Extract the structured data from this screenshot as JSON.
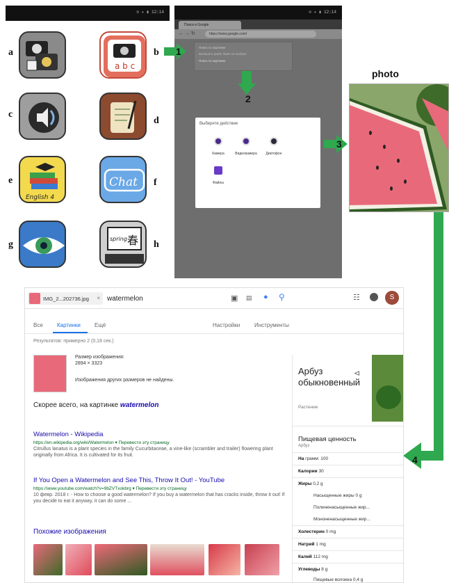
{
  "left_phone": {
    "status": "⊙ ✦ ▮ 12:14",
    "letters": [
      "a",
      "b",
      "c",
      "d",
      "e",
      "f",
      "g",
      "h"
    ],
    "english_label": "English 4",
    "chat_label": "Chat",
    "spring_label": "spring",
    "kanji_label": "春"
  },
  "right_phone": {
    "status": "⊙ ✦ ▮ 12:14",
    "tab_title": "Поиск в Google",
    "url": "https://www.google.com/",
    "popup_line1": "Поиск по картинке",
    "popup_line2": "Выберите файл  Файл не выбран",
    "popup_line3": "Поиск по картинке",
    "dialog": {
      "title": "Выберите действие",
      "options": [
        "Камера",
        "Видеокамера",
        "Диктофон",
        "Файлы"
      ]
    }
  },
  "arrows": [
    "1",
    "2",
    "3",
    "4"
  ],
  "photo": {
    "caption": "photo"
  },
  "google": {
    "image_chip": "IMG_2...202736.jpg",
    "query": "watermelon",
    "avatar_letter": "S",
    "tabs": [
      "Все",
      "Картинки",
      "Ещё",
      "Настройки",
      "Инструменты"
    ],
    "results_count": "Результатов: примерно 2 (0,18 сек.)",
    "image_size_label": "Размер изображения:",
    "image_size_value": "2894 × 3323",
    "other_sizes": "Изображения других размеров не найдены.",
    "best_guess_label": "Скорее всего, на картинке",
    "best_guess_term": "watermelon",
    "results": [
      {
        "title": "Watermelon - Wikipedia",
        "url": "https://en.wikipedia.org/wiki/Watermelon ▾ Перевести эту страницу",
        "snippet": "Citrullus lanatus is a plant species in the family Cucurbitaceae, a vine-like (scrambler and trailer) flowering plant originally from Africa. It is cultivated for its fruit."
      },
      {
        "title": "If You Open a Watermelon and See This, Throw It Out! - YouTube",
        "url": "https://www.youtube.com/watch?v=9bZVTxokbrg ▾ Перевести эту страницу",
        "snippet": "10 февр. 2018 г. - How to choose a good watermelon? If you buy a watermelon that has cracks inside, throw it out! If you decide to eat it anyway, it can do some ..."
      }
    ],
    "similar_heading": "Похожие изображения",
    "kp": {
      "title": "Арбуз обыкновенный",
      "subtitle": "Растение",
      "nutrition_heading": "Пищевая ценность",
      "nutrition_sub": "Арбуз",
      "rows": [
        {
          "label": "На",
          "value": "грамм: 100"
        },
        {
          "label": "Калории",
          "value": "30"
        },
        {
          "label": "Жиры",
          "value": "0,2 g"
        },
        {
          "label": "Насыщенные жиры 0 g"
        },
        {
          "label": "Полиненасыщенные жир..."
        },
        {
          "label": "Мононенасыщенные жир..."
        },
        {
          "label": "Холестерин",
          "value": "0 mg"
        },
        {
          "label": "Натрий",
          "value": "1 mg"
        },
        {
          "label": "Калий",
          "value": "112 mg"
        },
        {
          "label": "Углеводы",
          "value": "8 g"
        },
        {
          "label": "Пищевые волокна 0,4 g"
        }
      ]
    }
  }
}
